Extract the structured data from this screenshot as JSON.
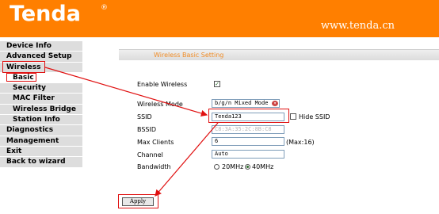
{
  "header": {
    "logo_text": "Tenda",
    "logo_reg": "®",
    "url": "www.tenda.cn"
  },
  "sidebar": {
    "items": [
      {
        "label": "Device Info"
      },
      {
        "label": "Advanced Setup"
      },
      {
        "label": "Wireless"
      },
      {
        "label": "Basic"
      },
      {
        "label": "Security"
      },
      {
        "label": "MAC Filter"
      },
      {
        "label": "Wireless Bridge"
      },
      {
        "label": "Station Info"
      },
      {
        "label": "Diagnostics"
      },
      {
        "label": "Management"
      },
      {
        "label": "Exit"
      },
      {
        "label": "Back to wizard"
      }
    ]
  },
  "main": {
    "section_title": "Wireless Basic Setting",
    "enable_wireless_label": "Enable Wireless",
    "wireless_mode_label": "Wireless Mode",
    "wireless_mode_value": "b/g/n Mixed Mode",
    "ssid_label": "SSID",
    "ssid_value": "Tenda123",
    "hide_ssid_label": "Hide SSID",
    "bssid_label": "BSSID",
    "bssid_value": "C8:3A:35:2C:8B:C8",
    "max_clients_label": "Max Clients",
    "max_clients_value": "6",
    "max_clients_hint": "(Max:16)",
    "channel_label": "Channel",
    "channel_value": "Auto",
    "bandwidth_label": "Bandwidth",
    "bandwidth_20": "20MHz",
    "bandwidth_40": "40MHz",
    "apply_label": "Apply"
  }
}
